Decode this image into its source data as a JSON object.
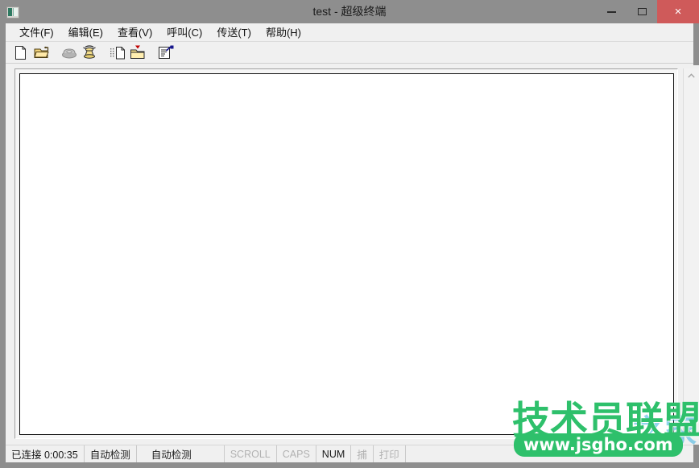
{
  "window": {
    "title": "test - 超级终端",
    "icon": "hyperterminal-icon",
    "controls": {
      "minimize": "minimize-icon",
      "maximize": "maximize-icon",
      "close": "×"
    },
    "colors": {
      "titlebar_bg": "#8e8e8e",
      "close_bg": "#cf5a5a",
      "client_bg": "#f0f0f0",
      "terminal_bg": "#ffffff",
      "watermark_green": "#2ec06b",
      "watermark_blue": "#39b1e0"
    }
  },
  "menubar": {
    "items": [
      {
        "label": "文件(F)",
        "name": "menu-file"
      },
      {
        "label": "编辑(E)",
        "name": "menu-edit"
      },
      {
        "label": "查看(V)",
        "name": "menu-view"
      },
      {
        "label": "呼叫(C)",
        "name": "menu-call"
      },
      {
        "label": "传送(T)",
        "name": "menu-transfer"
      },
      {
        "label": "帮助(H)",
        "name": "menu-help"
      }
    ]
  },
  "toolbar": {
    "buttons": [
      {
        "icon": "new-document-icon",
        "name": "toolbar-new"
      },
      {
        "icon": "open-folder-icon",
        "name": "toolbar-open"
      },
      {
        "icon": "phone-disconnect-icon",
        "name": "toolbar-disconnect"
      },
      {
        "icon": "phone-connect-icon",
        "name": "toolbar-connect"
      },
      {
        "icon": "send-file-icon",
        "name": "toolbar-send"
      },
      {
        "icon": "receive-file-icon",
        "name": "toolbar-receive"
      },
      {
        "icon": "properties-icon",
        "name": "toolbar-properties"
      }
    ]
  },
  "terminal": {
    "content": "",
    "scrollbar": {
      "up_arrow": "chevron-up-icon",
      "down_arrow": "chevron-down-icon"
    }
  },
  "statusbar": {
    "connection": "已连接 0:00:35",
    "detect_protocol": "自动检测",
    "detect_speed": "自动检测",
    "indicators": [
      {
        "label": "SCROLL",
        "active": false,
        "name": "status-scroll"
      },
      {
        "label": "CAPS",
        "active": false,
        "name": "status-caps"
      },
      {
        "label": "NUM",
        "active": true,
        "name": "status-num"
      },
      {
        "label": "捕",
        "active": false,
        "name": "status-capture"
      },
      {
        "label": "打印",
        "active": false,
        "name": "status-print"
      }
    ]
  },
  "watermark": {
    "brand": "技术员联盟",
    "url": "www.jsgho.com",
    "ghost": "之家"
  }
}
